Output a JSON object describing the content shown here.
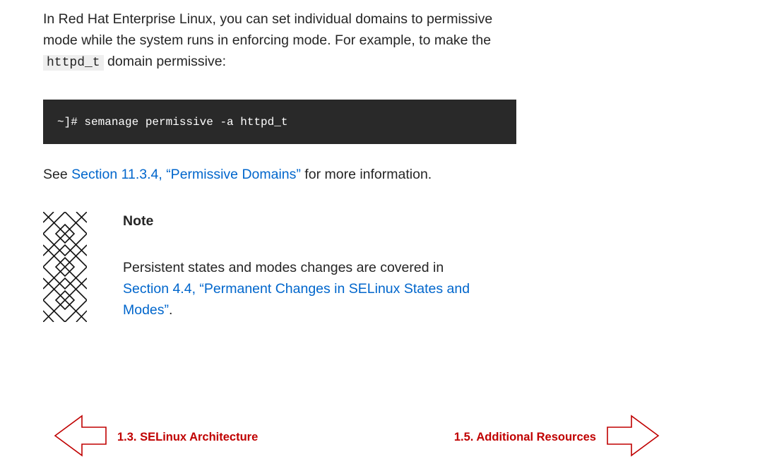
{
  "intro": {
    "text_before": "In Red Hat Enterprise Linux, you can set individual domains to permissive mode while the system runs in enforcing mode. For example, to make the ",
    "code": "httpd_t",
    "text_after": " domain permissive:"
  },
  "command": {
    "text": "~]# semanage permissive -a httpd_t"
  },
  "see_also": {
    "prefix": "See ",
    "link_text": "Section 11.3.4, “Permissive Domains”",
    "suffix": " for more information."
  },
  "note": {
    "icon": "note-pattern-icon",
    "title": "Note",
    "body_before": "Persistent states and modes changes are covered in ",
    "link_text": "Section 4.4, “Permanent Changes in SELinux States and Modes”",
    "body_after": "."
  },
  "navigation": {
    "prev_label": "1.3. SELinux Architecture",
    "next_label": "1.5. Additional Resources",
    "prev_icon": "arrow-left-icon",
    "next_icon": "arrow-right-icon"
  },
  "colors": {
    "link": "#0066cc",
    "nav": "#c00000",
    "code_bg": "#292929",
    "text": "#252525"
  }
}
